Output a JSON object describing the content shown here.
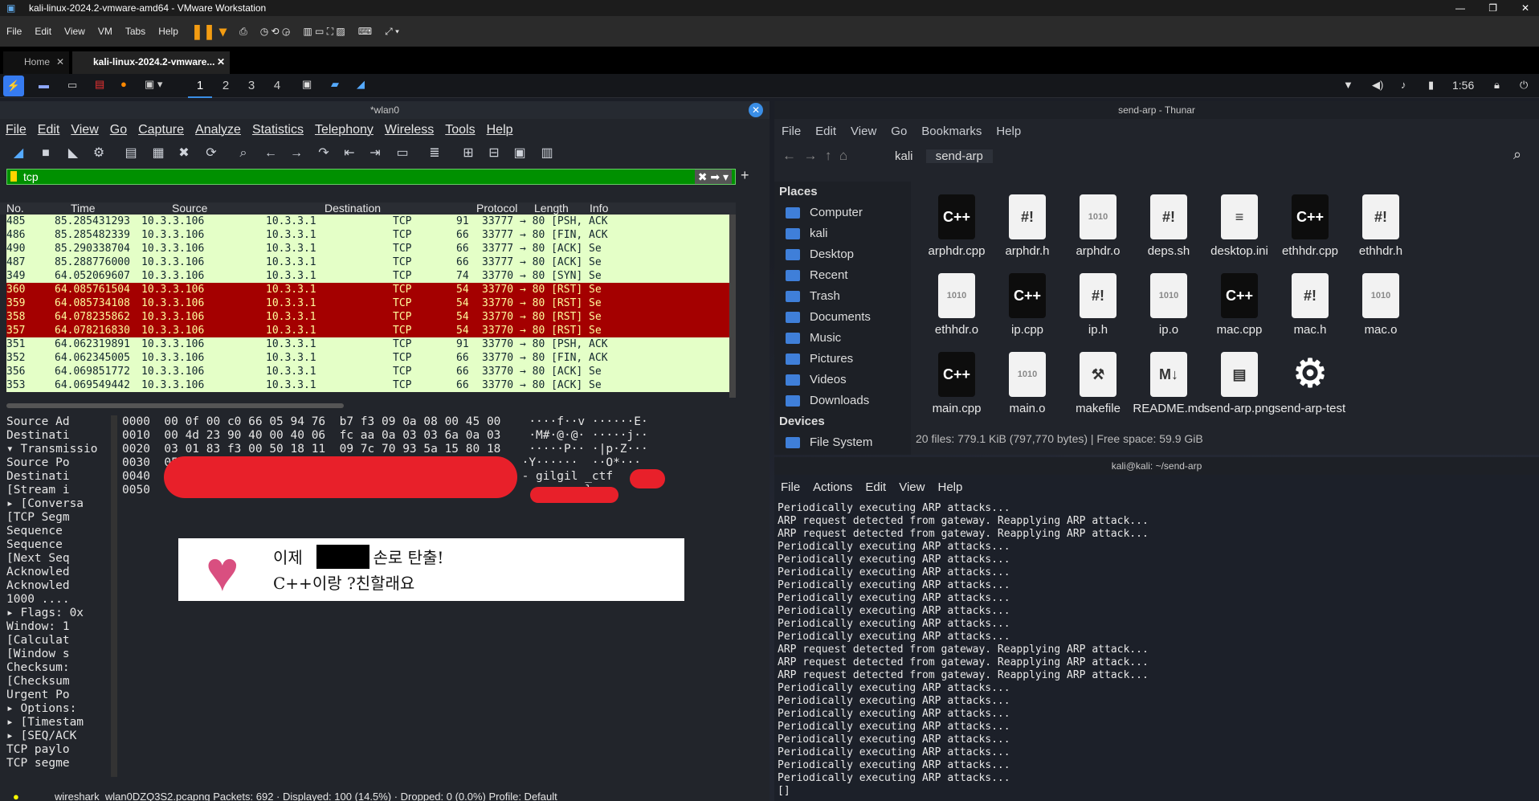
{
  "vmware": {
    "title": "kali-linux-2024.2-vmware-amd64 - VMware Workstation",
    "menu": [
      "File",
      "Edit",
      "View",
      "VM",
      "Tabs",
      "Help"
    ],
    "tabs": [
      "Home",
      "kali-linux-2024.2-vmware..."
    ]
  },
  "panel": {
    "workspaces": [
      "1",
      "2",
      "3",
      "4"
    ],
    "clock": "1:56"
  },
  "wireshark": {
    "title": "*wlan0",
    "menu": [
      "File",
      "Edit",
      "View",
      "Go",
      "Capture",
      "Analyze",
      "Statistics",
      "Telephony",
      "Wireless",
      "Tools",
      "Help"
    ],
    "filter": "tcp",
    "columns": [
      "No.",
      "Time",
      "Source",
      "Destination",
      "Protocol",
      "Length",
      "Info"
    ],
    "packets": [
      [
        "485",
        "85.285431293",
        "10.3.3.106",
        "10.3.3.1",
        "TCP",
        "91",
        "33777 → 80 [PSH, ACK",
        "ok"
      ],
      [
        "486",
        "85.285482339",
        "10.3.3.106",
        "10.3.3.1",
        "TCP",
        "66",
        "33777 → 80 [FIN, ACK",
        "ok"
      ],
      [
        "490",
        "85.290338704",
        "10.3.3.106",
        "10.3.3.1",
        "TCP",
        "66",
        "33777 → 80 [ACK] Se",
        "ok"
      ],
      [
        "487",
        "85.288776000",
        "10.3.3.106",
        "10.3.3.1",
        "TCP",
        "66",
        "33777 → 80 [ACK] Se",
        "ok"
      ],
      [
        "349",
        "64.052069607",
        "10.3.3.106",
        "10.3.3.1",
        "TCP",
        "74",
        "33770 → 80 [SYN] Se",
        "ok"
      ],
      [
        "360",
        "64.085761504",
        "10.3.3.106",
        "10.3.3.1",
        "TCP",
        "54",
        "33770 → 80 [RST] Se",
        "rst"
      ],
      [
        "359",
        "64.085734108",
        "10.3.3.106",
        "10.3.3.1",
        "TCP",
        "54",
        "33770 → 80 [RST] Se",
        "rst"
      ],
      [
        "358",
        "64.078235862",
        "10.3.3.106",
        "10.3.3.1",
        "TCP",
        "54",
        "33770 → 80 [RST] Se",
        "rst"
      ],
      [
        "357",
        "64.078216830",
        "10.3.3.106",
        "10.3.3.1",
        "TCP",
        "54",
        "33770 → 80 [RST] Se",
        "rst"
      ],
      [
        "351",
        "64.062319891",
        "10.3.3.106",
        "10.3.3.1",
        "TCP",
        "91",
        "33770 → 80 [PSH, ACK",
        "ok"
      ],
      [
        "352",
        "64.062345005",
        "10.3.3.106",
        "10.3.3.1",
        "TCP",
        "66",
        "33770 → 80 [FIN, ACK",
        "ok"
      ],
      [
        "356",
        "64.069851772",
        "10.3.3.106",
        "10.3.3.1",
        "TCP",
        "66",
        "33770 → 80 [ACK] Se",
        "ok"
      ],
      [
        "353",
        "64.069549442",
        "10.3.3.106",
        "10.3.3.1",
        "TCP",
        "66",
        "33770 → 80 [ACK] Se",
        "ok"
      ]
    ],
    "details": [
      "  Source Ad",
      "  Destinati",
      "▾ Transmissio",
      "    Source Po",
      "    Destinati",
      "    [Stream i",
      "  ▸ [Conversa",
      "    [TCP Segm",
      "    Sequence",
      "    Sequence",
      "    [Next Seq",
      "    Acknowled",
      "    Acknowled",
      "    1000 ....",
      "  ▸ Flags: 0x",
      "    Window: 1",
      "    [Calculat",
      "    [Window s",
      "    Checksum:",
      "    [Checksum",
      "    Urgent Po",
      "  ▸ Options:",
      "  ▸ [Timestam",
      "  ▸ [SEQ/ACK",
      "    TCP paylo",
      "    TCP segme"
    ],
    "hex": [
      "0000  00 0f 00 c0 66 05 94 76  b7 f3 09 0a 08 00 45 00    ····f··v ······E·",
      "0010  00 4d 23 90 40 00 40 06  fc aa 0a 03 03 6a 0a 03    ·M#·@·@· ·····j··",
      "0020  03 01 83 f3 00 50 18 11  09 7c 70 93 5a 15 80 18    ·····P·· ·|p·Z···",
      "0030  05 59 fc 03 00                                     ·Y······  ··O*···",
      "0040                                                     - gilgil _ctf",
      "0050                                                              }"
    ],
    "note_line1": "이제       님도 손로 탄출!",
    "note_line2": "C++이랑 ?친할래요",
    "status": "wireshark_wlan0DZQ3S2.pcapng      Packets: 692 · Displayed: 100 (14.5%) · Dropped: 0 (0.0%)    Profile: Default"
  },
  "thunar": {
    "title": "send-arp - Thunar",
    "menu": [
      "File",
      "Edit",
      "View",
      "Go",
      "Bookmarks",
      "Help"
    ],
    "path": [
      "kali",
      "send-arp"
    ],
    "places": [
      "Places",
      "Computer",
      "kali",
      "Desktop",
      "Recent",
      "Trash",
      "Documents",
      "Music",
      "Pictures",
      "Videos",
      "Downloads",
      "Devices",
      "File System"
    ],
    "files": [
      [
        "arphdr.cpp",
        "C++"
      ],
      [
        "arphdr.h",
        "#!"
      ],
      [
        "arphdr.o",
        "1010"
      ],
      [
        "deps.sh",
        "#!"
      ],
      [
        "desktop.ini",
        "≡"
      ],
      [
        "ethhdr.cpp",
        "C++"
      ],
      [
        "ethhdr.h",
        "#!"
      ],
      [
        "ethhdr.o",
        "1010"
      ],
      [
        "ip.cpp",
        "C++"
      ],
      [
        "ip.h",
        "#!"
      ],
      [
        "ip.o",
        "1010"
      ],
      [
        "mac.cpp",
        "C++"
      ],
      [
        "mac.h",
        "#!"
      ],
      [
        "mac.o",
        "1010"
      ],
      [
        "main.cpp",
        "C++"
      ],
      [
        "main.o",
        "1010"
      ],
      [
        "makefile",
        "⚒"
      ],
      [
        "README.md",
        "M↓"
      ],
      [
        "send-arp.png",
        "▤"
      ],
      [
        "send-arp-test",
        "⚙"
      ]
    ],
    "status": "20 files: 779.1 KiB (797,770 bytes)  |  Free space: 59.9 GiB"
  },
  "terminal": {
    "title": "kali@kali: ~/send-arp",
    "menu": [
      "File",
      "Actions",
      "Edit",
      "View",
      "Help"
    ],
    "lines": [
      "Periodically executing ARP attacks...",
      "ARP request detected from gateway. Reapplying ARP attack...",
      "ARP request detected from gateway. Reapplying ARP attack...",
      "Periodically executing ARP attacks...",
      "Periodically executing ARP attacks...",
      "Periodically executing ARP attacks...",
      "Periodically executing ARP attacks...",
      "Periodically executing ARP attacks...",
      "Periodically executing ARP attacks...",
      "Periodically executing ARP attacks...",
      "Periodically executing ARP attacks...",
      "ARP request detected from gateway. Reapplying ARP attack...",
      "ARP request detected from gateway. Reapplying ARP attack...",
      "ARP request detected from gateway. Reapplying ARP attack...",
      "Periodically executing ARP attacks...",
      "Periodically executing ARP attacks...",
      "Periodically executing ARP attacks...",
      "Periodically executing ARP attacks...",
      "Periodically executing ARP attacks...",
      "Periodically executing ARP attacks...",
      "Periodically executing ARP attacks...",
      "Periodically executing ARP attacks...",
      "[]"
    ]
  }
}
